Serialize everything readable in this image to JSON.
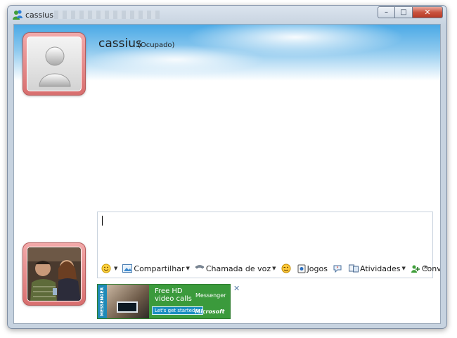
{
  "window": {
    "title": "cassius",
    "controls": {
      "minimize": "–",
      "maximize": "□",
      "close": "✕"
    }
  },
  "contact": {
    "name": "cassius",
    "status": "(Ocupado)"
  },
  "toolbar": {
    "share_label": "Compartilhar",
    "voice_call_label": "Chamada de voz",
    "games_label": "Jogos",
    "activities_label": "Atividades",
    "invite_label": "Convidar",
    "more_label": "»",
    "dropdown_glyph": "▼"
  },
  "ad": {
    "tip_label": "MESSENGER TIP",
    "headline_line1": "Free HD",
    "headline_line2": "video calls",
    "cta_label": "Let's get started ▷",
    "product_label": "Messenger",
    "company_label": "Microsoft",
    "close_glyph": "✕"
  },
  "icons": {
    "app": "messenger-icon",
    "emoticon": "emoticon-icon",
    "share": "share-icon",
    "voice_call": "phone-icon",
    "wink": "wink-icon",
    "games": "games-icon",
    "nudge": "nudge-icon",
    "activities": "activities-icon",
    "invite": "invite-icon"
  },
  "colors": {
    "avatar_frame": "#d86e6e",
    "sky_top": "#4aa9e6",
    "ad_green": "#3b9a3c",
    "ad_blue": "#1c8fc2"
  }
}
